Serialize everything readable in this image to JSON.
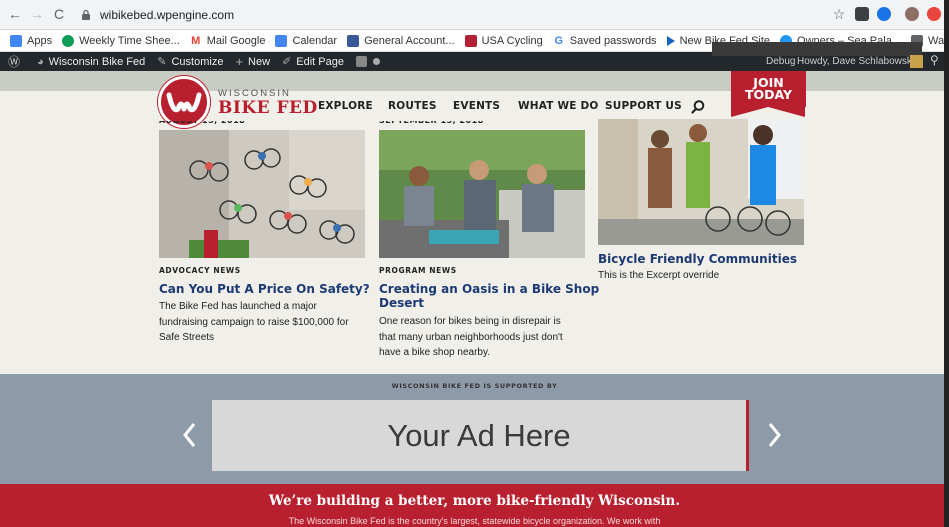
{
  "browser": {
    "url": "wibikebed.wpengine.com",
    "bookmarks": [
      {
        "label": "Apps",
        "icon": "apps-grid-icon",
        "color": "#4285f4"
      },
      {
        "label": "Weekly Time Shee...",
        "icon": "sheets-icon",
        "color": "#0f9d58"
      },
      {
        "label": "Mail Google",
        "icon": "gmail-icon",
        "color": "#ea4335"
      },
      {
        "label": "Calendar",
        "icon": "calendar-icon",
        "color": "#4285f4"
      },
      {
        "label": "General Account...",
        "icon": "facebook-icon",
        "color": "#3b5998"
      },
      {
        "label": "USA Cycling",
        "icon": "shield-icon",
        "color": "#b22234"
      },
      {
        "label": "Saved passwords",
        "icon": "google-icon",
        "color": "#4285f4"
      },
      {
        "label": "New Bike Fed Site",
        "icon": "play-icon",
        "color": "#1565c0"
      },
      {
        "label": "Owners – Sea Pala...",
        "icon": "globe-icon",
        "color": "#2196f3"
      },
      {
        "label": "Waterfalls",
        "icon": "folder-icon",
        "color": "#5f6368"
      }
    ]
  },
  "wp_admin": {
    "site_name": "Wisconsin Bike Fed",
    "customize": "Customize",
    "new": "New",
    "edit_page": "Edit Page",
    "debug": "Debug",
    "howdy": "Howdy, Dave Schlabowske"
  },
  "site": {
    "logo_line1": "WISCONSIN",
    "logo_line2": "BIKE FED",
    "nav": [
      "EXPLORE",
      "ROUTES",
      "EVENTS",
      "WHAT WE DO",
      "SUPPORT US"
    ],
    "join_line1": "JOIN",
    "join_line2": "TODAY",
    "colors": {
      "brand_red": "#b9202f",
      "title_blue": "#1d3a73"
    }
  },
  "posts": [
    {
      "date": "AUGUST 15, 2018",
      "category": "ADVOCACY NEWS",
      "title": "Can You Put A Price On Safety?",
      "excerpt": [
        "The Bike Fed has launched a major",
        "fundraising campaign to raise $100,000 for",
        "Safe Streets"
      ]
    },
    {
      "date": "SEPTEMBER 15, 2018",
      "category": "PROGRAM NEWS",
      "title_lines": [
        "Creating an Oasis in a Bike Shop",
        "Desert"
      ],
      "excerpt": [
        "One reason for bikes being in disrepair is",
        "that many urban neighborhoods just don't",
        "have a bike shop nearby."
      ]
    },
    {
      "title": "Bicycle Friendly Communities",
      "excerpt": [
        "This is the Excerpt override"
      ]
    }
  ],
  "sponsor": {
    "label": "WISCONSIN BIKE FED IS SUPPORTED BY",
    "ad_text": "Your Ad Here"
  },
  "footer": {
    "headline": "We’re building a better, more bike-friendly Wisconsin.",
    "text": "The Wisconsin Bike Fed is the country's largest, statewide bicycle organization. We work with"
  }
}
